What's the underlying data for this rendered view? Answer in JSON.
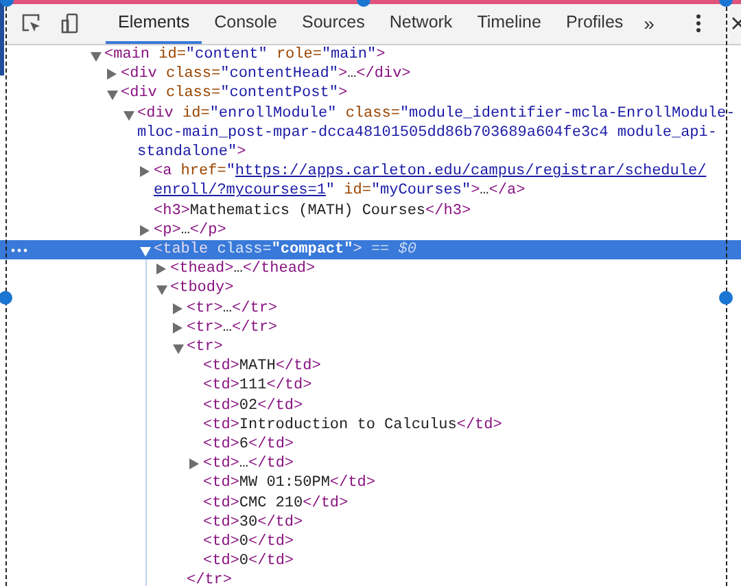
{
  "toolbar": {
    "tabs": [
      {
        "label": "Elements",
        "selected": true
      },
      {
        "label": "Console",
        "selected": false
      },
      {
        "label": "Sources",
        "selected": false
      },
      {
        "label": "Network",
        "selected": false
      },
      {
        "label": "Timeline",
        "selected": false
      },
      {
        "label": "Profiles",
        "selected": false
      }
    ],
    "more": "»"
  },
  "tree": [
    {
      "selected": false,
      "expanded": true,
      "tokens": [
        {
          "kind": "tag",
          "text": "<main"
        },
        {
          "kind": "attr",
          "text": " id="
        },
        {
          "kind": "value",
          "text": "\"content\""
        },
        {
          "kind": "attr",
          "text": " role="
        },
        {
          "kind": "value",
          "text": "\"main\""
        },
        {
          "kind": "tag",
          "text": ">"
        }
      ],
      "children": [
        {
          "selected": false,
          "expanded": false,
          "tokens": [
            {
              "kind": "tag",
              "text": "<div"
            },
            {
              "kind": "attr",
              "text": " class="
            },
            {
              "kind": "value",
              "text": "\"contentHead\""
            },
            {
              "kind": "tag",
              "text": ">"
            },
            {
              "kind": "text",
              "text": "…"
            },
            {
              "kind": "tag",
              "text": "</div>"
            }
          ]
        },
        {
          "selected": false,
          "expanded": true,
          "tokens": [
            {
              "kind": "tag",
              "text": "<div"
            },
            {
              "kind": "attr",
              "text": " class="
            },
            {
              "kind": "value",
              "text": "\"contentPost\""
            },
            {
              "kind": "tag",
              "text": ">"
            }
          ],
          "children": [
            {
              "selected": false,
              "expanded": true,
              "tokens": [
                {
                  "kind": "tag",
                  "text": "<div"
                },
                {
                  "kind": "attr",
                  "text": " id="
                },
                {
                  "kind": "value",
                  "text": "\"enrollModule\""
                },
                {
                  "kind": "attr",
                  "text": " class="
                },
                {
                  "kind": "value",
                  "text": "\"module_identifier-mcla-EnrollModule-mloc-main_post-mpar-dcca48101505dd86b703689a604fe3c4 module_api-standalone\""
                },
                {
                  "kind": "tag",
                  "text": ">"
                }
              ],
              "children": [
                {
                  "selected": false,
                  "expanded": false,
                  "tokens": [
                    {
                      "kind": "tag",
                      "text": "<a"
                    },
                    {
                      "kind": "attr",
                      "text": " href="
                    },
                    {
                      "kind": "value",
                      "text": "\""
                    },
                    {
                      "kind": "link",
                      "text": "https://apps.carleton.edu/campus/registrar/schedule/"
                    },
                    {
                      "kind": "link",
                      "text": "enroll/?mycourses=1"
                    },
                    {
                      "kind": "value",
                      "text": "\""
                    },
                    {
                      "kind": "attr",
                      "text": " id="
                    },
                    {
                      "kind": "value",
                      "text": "\"myCourses\""
                    },
                    {
                      "kind": "tag",
                      "text": ">"
                    },
                    {
                      "kind": "text",
                      "text": "…"
                    },
                    {
                      "kind": "tag",
                      "text": "</a>"
                    }
                  ]
                },
                {
                  "selected": false,
                  "tokens": [
                    {
                      "kind": "tag",
                      "text": "<h3>"
                    },
                    {
                      "kind": "text",
                      "text": "Mathematics (MATH) Courses"
                    },
                    {
                      "kind": "tag",
                      "text": "</h3>"
                    }
                  ]
                },
                {
                  "selected": false,
                  "expanded": false,
                  "tokens": [
                    {
                      "kind": "tag",
                      "text": "<p>"
                    },
                    {
                      "kind": "text",
                      "text": "…"
                    },
                    {
                      "kind": "tag",
                      "text": "</p>"
                    }
                  ]
                },
                {
                  "selected": true,
                  "expanded": true,
                  "tokens": [
                    {
                      "kind": "tag",
                      "text": "<table"
                    },
                    {
                      "kind": "attr",
                      "text": " class="
                    },
                    {
                      "kind": "value",
                      "text": "\"compact\""
                    },
                    {
                      "kind": "tag",
                      "text": ">"
                    },
                    {
                      "kind": "eq",
                      "text": " == "
                    },
                    {
                      "kind": "ref",
                      "text": "$0"
                    }
                  ],
                  "children": [
                    {
                      "selected": false,
                      "expanded": false,
                      "tokens": [
                        {
                          "kind": "tag",
                          "text": "<thead>"
                        },
                        {
                          "kind": "text",
                          "text": "…"
                        },
                        {
                          "kind": "tag",
                          "text": "</thead>"
                        }
                      ]
                    },
                    {
                      "selected": false,
                      "expanded": true,
                      "tokens": [
                        {
                          "kind": "tag",
                          "text": "<tbody>"
                        }
                      ],
                      "children": [
                        {
                          "selected": false,
                          "expanded": false,
                          "tokens": [
                            {
                              "kind": "tag",
                              "text": "<tr>"
                            },
                            {
                              "kind": "text",
                              "text": "…"
                            },
                            {
                              "kind": "tag",
                              "text": "</tr>"
                            }
                          ]
                        },
                        {
                          "selected": false,
                          "expanded": false,
                          "tokens": [
                            {
                              "kind": "tag",
                              "text": "<tr>"
                            },
                            {
                              "kind": "text",
                              "text": "…"
                            },
                            {
                              "kind": "tag",
                              "text": "</tr>"
                            }
                          ]
                        },
                        {
                          "selected": false,
                          "expanded": true,
                          "tokens": [
                            {
                              "kind": "tag",
                              "text": "<tr>"
                            }
                          ],
                          "end": "</tr>",
                          "children": [
                            {
                              "selected": false,
                              "tokens": [
                                {
                                  "kind": "tag",
                                  "text": "<td>"
                                },
                                {
                                  "kind": "text",
                                  "text": "MATH"
                                },
                                {
                                  "kind": "tag",
                                  "text": "</td>"
                                }
                              ]
                            },
                            {
                              "selected": false,
                              "tokens": [
                                {
                                  "kind": "tag",
                                  "text": "<td>"
                                },
                                {
                                  "kind": "text",
                                  "text": "111"
                                },
                                {
                                  "kind": "tag",
                                  "text": "</td>"
                                }
                              ]
                            },
                            {
                              "selected": false,
                              "tokens": [
                                {
                                  "kind": "tag",
                                  "text": "<td>"
                                },
                                {
                                  "kind": "text",
                                  "text": "02"
                                },
                                {
                                  "kind": "tag",
                                  "text": "</td>"
                                }
                              ]
                            },
                            {
                              "selected": false,
                              "tokens": [
                                {
                                  "kind": "tag",
                                  "text": "<td>"
                                },
                                {
                                  "kind": "text",
                                  "text": "Introduction to Calculus"
                                },
                                {
                                  "kind": "tag",
                                  "text": "</td>"
                                }
                              ]
                            },
                            {
                              "selected": false,
                              "tokens": [
                                {
                                  "kind": "tag",
                                  "text": "<td>"
                                },
                                {
                                  "kind": "text",
                                  "text": "6"
                                },
                                {
                                  "kind": "tag",
                                  "text": "</td>"
                                }
                              ]
                            },
                            {
                              "selected": false,
                              "expanded": false,
                              "tokens": [
                                {
                                  "kind": "tag",
                                  "text": "<td>"
                                },
                                {
                                  "kind": "text",
                                  "text": "…"
                                },
                                {
                                  "kind": "tag",
                                  "text": "</td>"
                                }
                              ]
                            },
                            {
                              "selected": false,
                              "tokens": [
                                {
                                  "kind": "tag",
                                  "text": "<td>"
                                },
                                {
                                  "kind": "text",
                                  "text": "MW 01:50PM"
                                },
                                {
                                  "kind": "tag",
                                  "text": "</td>"
                                }
                              ]
                            },
                            {
                              "selected": false,
                              "tokens": [
                                {
                                  "kind": "tag",
                                  "text": "<td>"
                                },
                                {
                                  "kind": "text",
                                  "text": "CMC 210"
                                },
                                {
                                  "kind": "tag",
                                  "text": "</td>"
                                }
                              ]
                            },
                            {
                              "selected": false,
                              "tokens": [
                                {
                                  "kind": "tag",
                                  "text": "<td>"
                                },
                                {
                                  "kind": "text",
                                  "text": "30"
                                },
                                {
                                  "kind": "tag",
                                  "text": "</td>"
                                }
                              ]
                            },
                            {
                              "selected": false,
                              "tokens": [
                                {
                                  "kind": "tag",
                                  "text": "<td>"
                                },
                                {
                                  "kind": "text",
                                  "text": "0"
                                },
                                {
                                  "kind": "tag",
                                  "text": "</td>"
                                }
                              ]
                            },
                            {
                              "selected": false,
                              "tokens": [
                                {
                                  "kind": "tag",
                                  "text": "<td>"
                                },
                                {
                                  "kind": "text",
                                  "text": "0"
                                },
                                {
                                  "kind": "tag",
                                  "text": "</td>"
                                }
                              ]
                            }
                          ]
                        }
                      ]
                    }
                  ]
                }
              ]
            }
          ]
        }
      ]
    }
  ]
}
